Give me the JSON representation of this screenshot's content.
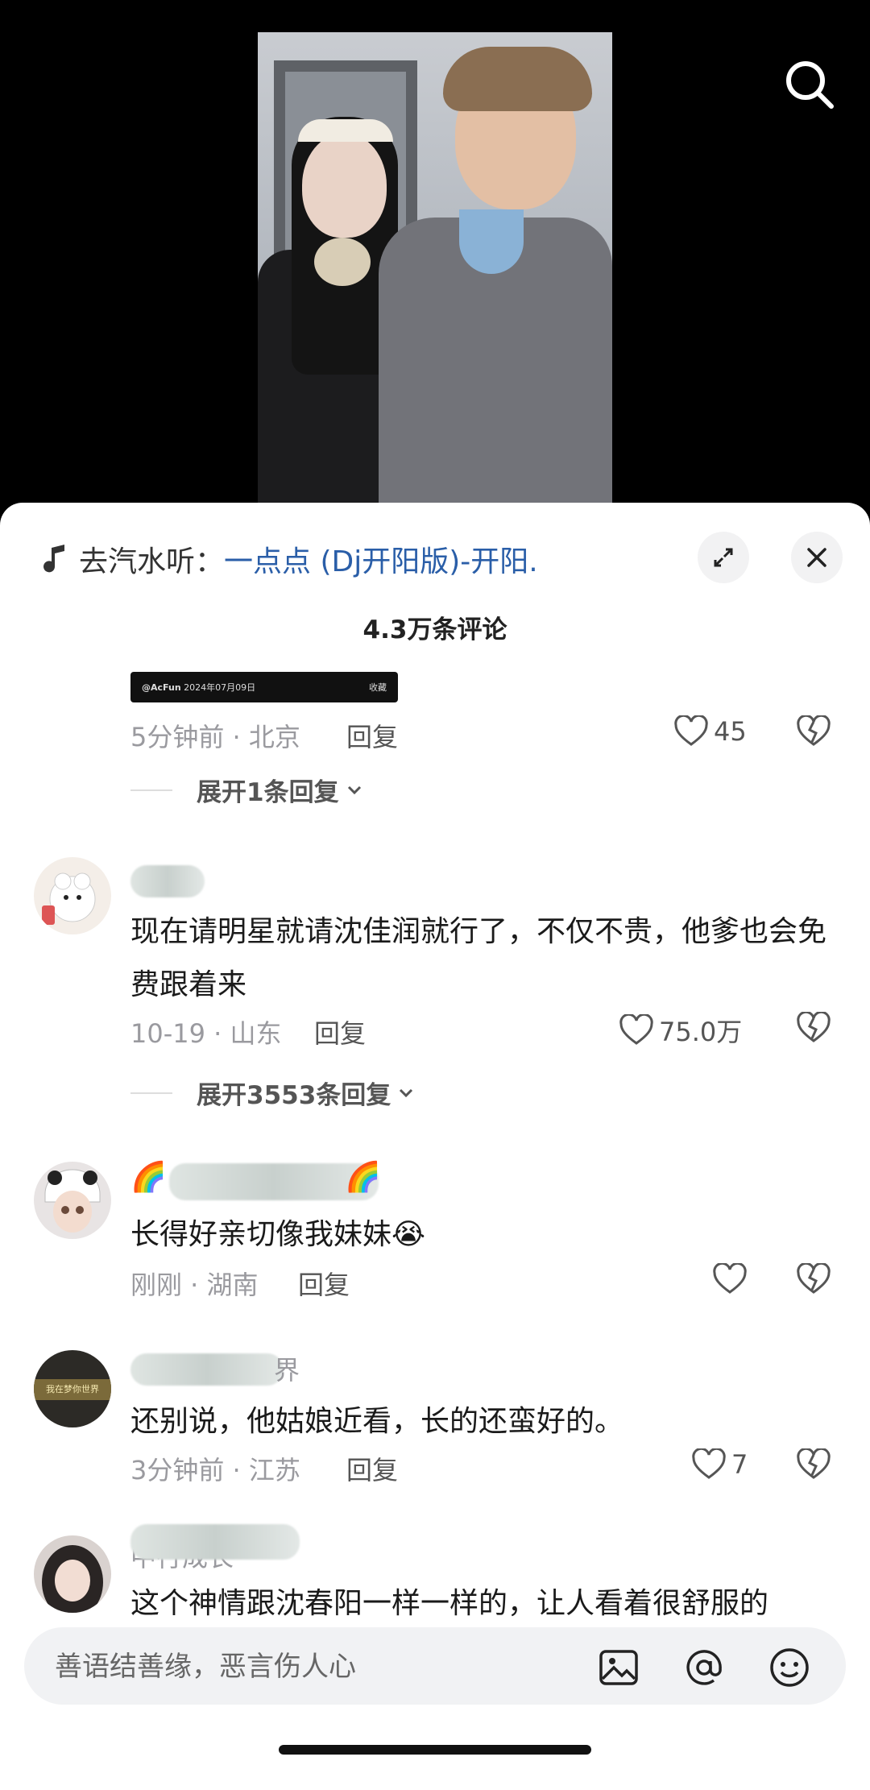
{
  "music": {
    "prefix": "去汽水听：",
    "song": "一点点 (Dj开阳版)-开阳."
  },
  "comment_count": "4.3万条评论",
  "first_comment": {
    "image_watermark": "@AcFun",
    "image_date": "2024年07月09日",
    "image_tag": "收藏",
    "meta": "5分钟前 · 北京",
    "reply_label": "回复",
    "likes": "45",
    "expand_label": "展开1条回复"
  },
  "comments": [
    {
      "text": "现在请明星就请沈佳润就行了，不仅不贵，他爹也会免费跟着来",
      "meta": "10-19 · 山东",
      "reply_label": "回复",
      "likes": "75.0万",
      "expand_label": "展开3553条回复"
    },
    {
      "text": "长得好亲切像我妹妹😭",
      "meta": "刚刚 · 湖南",
      "reply_label": "回复",
      "likes": "",
      "name_deco": "🌈"
    },
    {
      "text": "还别说，他姑娘近看，长的还蛮好的。",
      "meta": "3分钟前 · 江苏",
      "reply_label": "回复",
      "likes": "7",
      "name_partial": "界",
      "avatar_text": "我在梦你世界"
    },
    {
      "text": "这个神情跟沈春阳一样一样的，让人看着很舒服的",
      "name_partial": "中行成长"
    }
  ],
  "input": {
    "placeholder": "善语结善缘，恶言伤人心"
  },
  "colors": {
    "link": "#2a5ea8",
    "sheet_bg": "#ffffff",
    "meta_gray": "#9a9a9f"
  },
  "icons": [
    "music-note-icon",
    "expand-icon",
    "close-icon",
    "search-icon",
    "heart-icon",
    "broken-heart-icon",
    "image-icon",
    "at-icon",
    "emoji-icon",
    "chevron-down-icon"
  ]
}
